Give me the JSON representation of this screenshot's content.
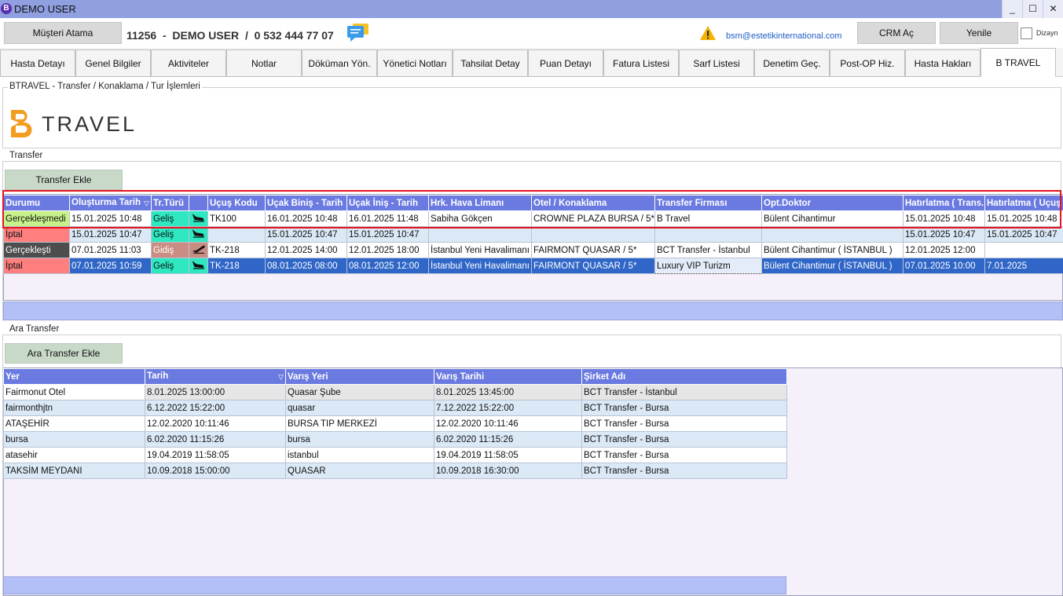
{
  "window": {
    "title": "DEMO USER",
    "logo_letter": "B",
    "minimize": "_",
    "maximize": "☐",
    "close": "✕"
  },
  "header": {
    "assign_button": "Müşteri Atama",
    "patient_line": "11256  -  DEMO USER  /  0 532 444 77 07",
    "email": "bsm@estetikinternational.com",
    "crm_button": "CRM Aç",
    "refresh_button": "Yenile",
    "design_label": "Dizayn"
  },
  "tabs": [
    "Hasta Detayı",
    "Genel Bilgiler",
    "Aktiviteler",
    "Notlar",
    "Döküman Yön.",
    "Yönetici Notları",
    "Tahsilat Detay",
    "Puan Detayı",
    "Fatura Listesi",
    "Sarf Listesi",
    "Denetim Geç.",
    "Post-OP Hiz.",
    "Hasta Hakları",
    "B TRAVEL"
  ],
  "btravel": {
    "section_title": "BTRAVEL - Transfer / Konaklama / Tur İşlemleri",
    "logo_text": "TRAVEL",
    "brand_color": "#f39c1f"
  },
  "transfer": {
    "section_title": "Transfer",
    "add_button": "Transfer Ekle",
    "columns": [
      "Durumu",
      "Oluşturma Tarih",
      "Tr.Türü",
      "",
      "Uçuş Kodu",
      "Uçak Biniş - Tarih",
      "Uçak İniş - Tarih",
      "Hrk. Hava Limanı",
      "Otel / Konaklama",
      "Transfer Firması",
      "Opt.Doktor",
      "Hatırlatma ( Trans.",
      "Hatırlatma ( Uçuş"
    ],
    "rows": [
      [
        "Gerçekleşmedi",
        "15.01.2025 10:48",
        "Geliş",
        "",
        "TK100",
        "16.01.2025 10:48",
        "16.01.2025 11:48",
        "Sabiha Gökçen",
        "CROWNE PLAZA BURSA / 5*",
        "B Travel",
        "Bülent Cihantimur",
        "15.01.2025 10:48",
        "15.01.2025 10:48"
      ],
      [
        "İptal",
        "15.01.2025 10:47",
        "Geliş",
        "",
        "",
        "15.01.2025 10:47",
        "15.01.2025 10:47",
        "",
        "",
        "",
        "",
        "15.01.2025 10:47",
        "15.01.2025 10:47"
      ],
      [
        "Gerçekleşti",
        "07.01.2025 11:03",
        "Gidiş",
        "",
        "TK-218",
        "12.01.2025 14:00",
        "12.01.2025 18:00",
        "İstanbul Yeni Havalimanı",
        "FAIRMONT QUASAR / 5*",
        "BCT Transfer - İstanbul",
        "Bülent Cihantimur ( İSTANBUL )",
        "12.01.2025 12:00",
        ""
      ],
      [
        "İptal",
        "07.01.2025 10:59",
        "Geliş",
        "",
        "TK-218",
        "08.01.2025 08:00",
        "08.01.2025 12:00",
        "İstanbul Yeni Havalimanı",
        "FAIRMONT QUASAR / 5*",
        "Luxury VIP Turizm",
        "Bülent Cihantimur ( İSTANBUL )",
        "07.01.2025 10:00",
        "7.01.2025"
      ]
    ],
    "status_colors": {
      "Gerçekleşmedi": "#c7f28a",
      "İptal": "#ff7f7f",
      "Gerçekleşti": "#4d4d4d"
    },
    "type_colors": {
      "Geliş": "#2ee8c1",
      "Gidiş": "#c98d83"
    }
  },
  "ara_transfer": {
    "section_title": "Ara Transfer",
    "add_button": "Ara Transfer Ekle",
    "columns": [
      "Yer",
      "Tarih",
      "Varış Yeri",
      "Varış Tarihi",
      "Şirket Adı"
    ],
    "rows": [
      [
        "Fairmonut Otel",
        "8.01.2025 13:00:00",
        "Quasar Şube",
        "8.01.2025 13:45:00",
        "BCT Transfer - İstanbul"
      ],
      [
        "fairmonthjtn",
        "6.12.2022 15:22:00",
        "quasar",
        "7.12.2022 15:22:00",
        "BCT Transfer - Bursa"
      ],
      [
        "ATAŞEHİR",
        "12.02.2020 10:11:46",
        "BURSA TIP MERKEZİ",
        "12.02.2020 10:11:46",
        "BCT Transfer - Bursa"
      ],
      [
        "bursa",
        "6.02.2020 11:15:26",
        "bursa",
        "6.02.2020 11:15:26",
        "BCT Transfer - Bursa"
      ],
      [
        "atasehir",
        "19.04.2019 11:58:05",
        "istanbul",
        "19.04.2019 11:58:05",
        "BCT Transfer - Bursa"
      ],
      [
        "TAKSİM MEYDANI",
        "10.09.2018 15:00:00",
        "QUASAR",
        "10.09.2018 16:30:00",
        "BCT Transfer - Bursa"
      ]
    ]
  }
}
